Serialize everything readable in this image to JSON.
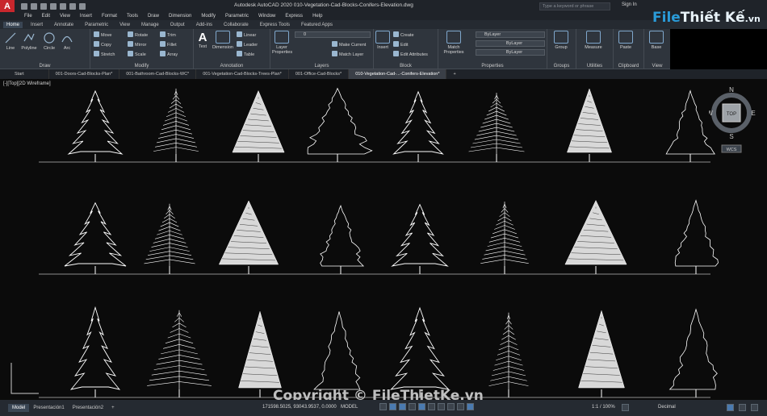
{
  "app": {
    "logo": "A",
    "title": "Autodesk AutoCAD 2020   010-Vegetation-Cad-Blocks-Conifers-Elevation.dwg",
    "search_placeholder": "Type a keyword or phrase",
    "signin": "Sign In"
  },
  "menu": [
    "File",
    "Edit",
    "View",
    "Insert",
    "Format",
    "Tools",
    "Draw",
    "Dimension",
    "Modify",
    "Parametric",
    "Window",
    "Express",
    "Help"
  ],
  "ribbon_tabs": [
    "Home",
    "Insert",
    "Annotate",
    "Parametric",
    "View",
    "Manage",
    "Output",
    "Add-ins",
    "Collaborate",
    "Express Tools",
    "Featured Apps"
  ],
  "ribbon": {
    "draw": {
      "title": "Draw",
      "line": "Line",
      "polyline": "Polyline",
      "circle": "Circle",
      "arc": "Arc"
    },
    "modify": {
      "title": "Modify",
      "move": "Move",
      "rotate": "Rotate",
      "trim": "Trim",
      "copy": "Copy",
      "mirror": "Mirror",
      "fillet": "Fillet",
      "stretch": "Stretch",
      "scale": "Scale",
      "array": "Array"
    },
    "annotation": {
      "title": "Annotation",
      "text": "Text",
      "dimension": "Dimension",
      "linear": "Linear",
      "leader": "Leader",
      "table": "Table"
    },
    "layers": {
      "title": "Layers",
      "layer_properties": "Layer Properties",
      "current_layer": "0",
      "make_current": "Make Current",
      "match_layer": "Match Layer"
    },
    "block": {
      "title": "Block",
      "insert": "Insert",
      "create": "Create",
      "edit": "Edit",
      "edit_attributes": "Edit Attributes"
    },
    "properties": {
      "title": "Properties",
      "match": "Match Properties",
      "color": "ByLayer",
      "linetype": "ByLayer",
      "lineweight": "ByLayer"
    },
    "groups": {
      "title": "Groups",
      "group": "Group"
    },
    "utilities": {
      "title": "Utilities",
      "measure": "Measure"
    },
    "clipboard": {
      "title": "Clipboard",
      "paste": "Paste"
    },
    "view": {
      "title": "View",
      "base": "Base"
    }
  },
  "file_tabs": [
    "Start",
    "001-Doors-Cad-Blocks-Plan*",
    "001-Bathroom-Cad-Blocks-WC*",
    "001-Vegetation-Cad-Blocks-Trees-Plan*",
    "001-Office-Cad-Blocks*",
    "010-Vegetation-Cad-...-Conifers-Elevation*"
  ],
  "viewport": {
    "label": "[-][Top][2D Wireframe]",
    "viewcube": {
      "n": "N",
      "s": "S",
      "e": "E",
      "w": "W",
      "top": "TOP",
      "wcs": "WCS"
    }
  },
  "status": {
    "layout_tabs": [
      "Model",
      "Presentación1",
      "Presentación2"
    ],
    "coords": "171598.5025, 93043.9537, 0.0000",
    "mode": "MODEL",
    "scale": "1:1 / 100%",
    "units": "Decimal"
  },
  "watermark": "Copyright © FileThietKe.vn",
  "brand": {
    "mark": "File",
    "name": "Thiết Kế",
    "tld": ".vn"
  }
}
